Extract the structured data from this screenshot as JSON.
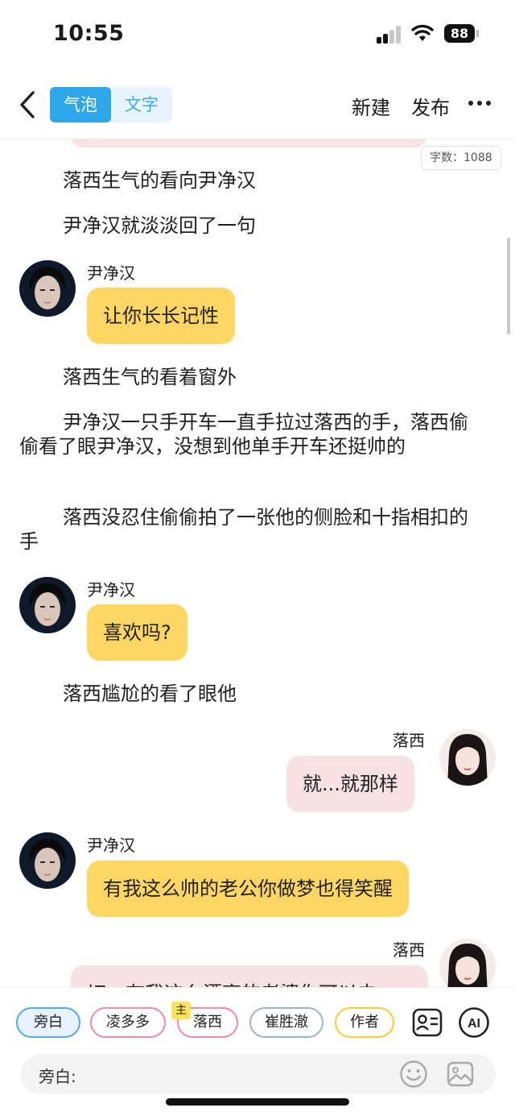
{
  "status_bar": {
    "time": "10:55",
    "battery": "88"
  },
  "nav": {
    "tabs": [
      {
        "label": "气泡",
        "active": true
      },
      {
        "label": "文字",
        "active": false
      }
    ],
    "new_label": "新建",
    "publish_label": "发布"
  },
  "word_count": "字数：1088",
  "paragraphs": [
    "落西生气的看向尹净汉",
    "尹净汉就淡淡回了一句",
    "落西生气的看着窗外",
    "尹净汉一只手开车一直手拉过落西的手，落西偷偷看了眼尹净汉，没想到他单手开车还挺帅的",
    "落西没忍住偷偷拍了一张他的侧脸和十指相扣的手",
    "落西尴尬的看了眼他"
  ],
  "messages": [
    {
      "speaker": "尹净汉",
      "text": "让你长长记性",
      "side": "left"
    },
    {
      "speaker": "尹净汉",
      "text": "喜欢吗?",
      "side": "left"
    },
    {
      "speaker": "落西",
      "text": "就...就那样",
      "side": "right"
    },
    {
      "speaker": "尹净汉",
      "text": "有我这么帅的老公你做梦也得笑醒",
      "side": "left"
    },
    {
      "speaker": "落西",
      "text": "切，有我这么漂亮的老婆你可以去",
      "side": "right"
    }
  ],
  "characters": [
    {
      "label": "旁白",
      "color": "#53a9ec"
    },
    {
      "label": "凌多多",
      "color": "#f08aa6"
    },
    {
      "label": "落西",
      "color": "#f08aa6",
      "tag": "主"
    },
    {
      "label": "崔胜澈",
      "color": "#9bb4d0"
    },
    {
      "label": "作者",
      "color": "#f5cf3a"
    }
  ],
  "ai_label": "AI",
  "input": {
    "label": "旁白:",
    "value": ""
  },
  "colors": {
    "accent": "#2ea6ea",
    "left_bubble": "#fdd663",
    "right_bubble": "#f6e1e3"
  }
}
